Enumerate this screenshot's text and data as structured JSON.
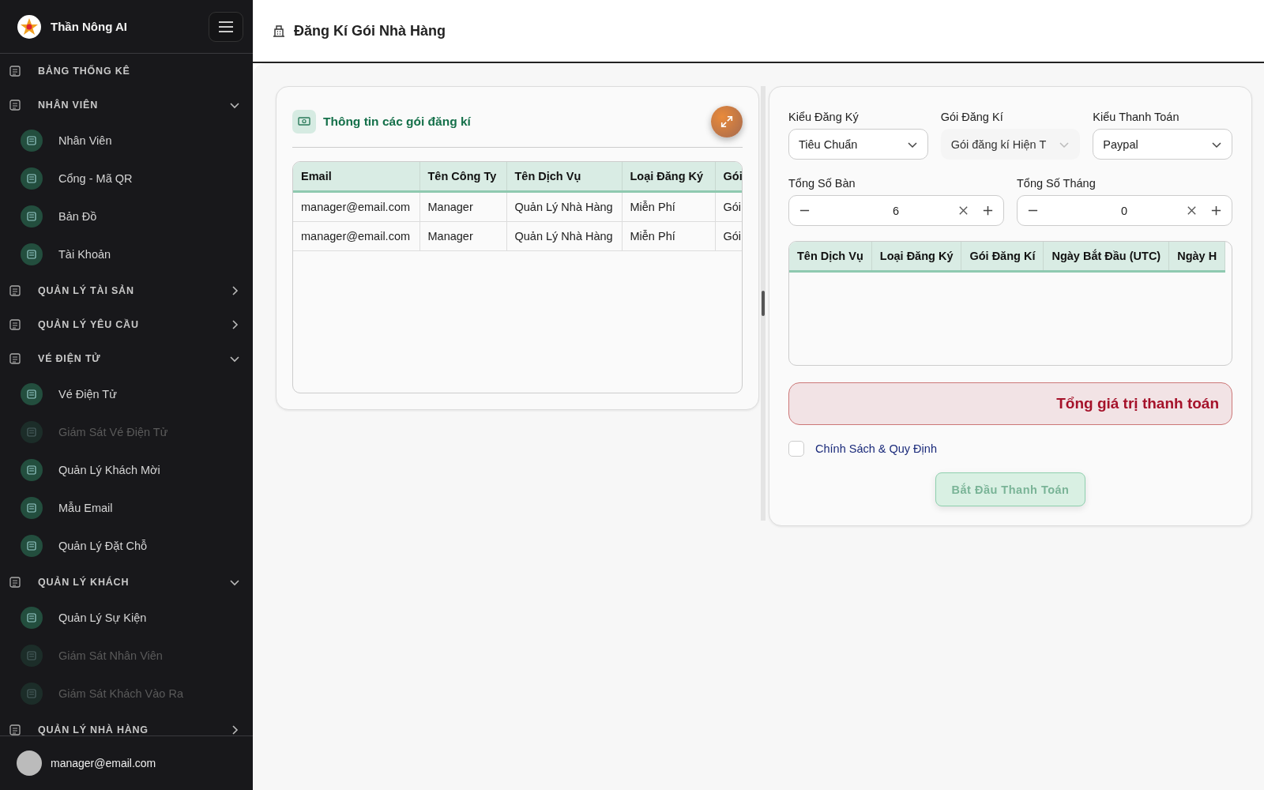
{
  "sidebar": {
    "brand": "Thần Nông AI",
    "items": [
      {
        "kind": "section",
        "label": "BẢNG THỐNG KÊ"
      },
      {
        "kind": "section",
        "label": "NHÂN VIÊN",
        "expanded": true,
        "children": [
          {
            "label": "Nhân Viên",
            "disabled": false
          },
          {
            "label": "Cổng - Mã QR",
            "disabled": false
          },
          {
            "label": "Bản Đồ",
            "disabled": false
          },
          {
            "label": "Tài Khoản",
            "disabled": false
          }
        ]
      },
      {
        "kind": "section",
        "label": "QUẢN LÝ TÀI SẢN",
        "expanded": false
      },
      {
        "kind": "section",
        "label": "QUẢN LÝ YÊU CẦU",
        "expanded": false
      },
      {
        "kind": "section",
        "label": "VÉ ĐIỆN TỬ",
        "expanded": true,
        "children": [
          {
            "label": "Vé Điện Tử",
            "disabled": false
          },
          {
            "label": "Giám Sát Vé Điện Tử",
            "disabled": true
          },
          {
            "label": "Quản Lý Khách Mời",
            "disabled": false
          },
          {
            "label": "Mẫu Email",
            "disabled": false
          },
          {
            "label": "Quản Lý Đặt Chỗ",
            "disabled": false
          }
        ]
      },
      {
        "kind": "section",
        "label": "QUẢN LÝ KHÁCH",
        "expanded": true,
        "children": [
          {
            "label": "Quản Lý Sự Kiện",
            "disabled": false
          },
          {
            "label": "Giám Sát Nhân Viên",
            "disabled": true
          },
          {
            "label": "Giám Sát Khách Vào Ra",
            "disabled": true
          }
        ]
      },
      {
        "kind": "section",
        "label": "QUẢN LÝ NHÀ HÀNG",
        "expanded": false
      }
    ],
    "user": "manager@email.com"
  },
  "page_title": "Đăng Kí Gói Nhà Hàng",
  "packages_panel": {
    "title": "Thông tin các gói đăng kí",
    "table": {
      "columns": [
        "Email",
        "Tên Công Ty",
        "Tên Dịch Vụ",
        "Loại Đăng Ký",
        "Gói"
      ],
      "rows": [
        [
          "manager@email.com",
          "Manager",
          "Quản Lý Nhà Hàng",
          "Miễn Phí",
          "Gói"
        ],
        [
          "manager@email.com",
          "Manager",
          "Quản Lý Nhà Hàng",
          "Miễn Phí",
          "Gói"
        ]
      ]
    }
  },
  "form": {
    "selects": [
      {
        "label": "Kiểu Đăng Ký",
        "value": "Tiêu Chuẩn",
        "disabled": false
      },
      {
        "label": "Gói Đăng Kí",
        "value": "Gói đăng kí Hiện T",
        "disabled": true
      },
      {
        "label": "Kiểu Thanh Toán",
        "value": "Paypal",
        "disabled": false
      }
    ],
    "steppers": [
      {
        "label": "Tổng Số Bàn",
        "value": "6"
      },
      {
        "label": "Tổng Số Tháng",
        "value": "0"
      }
    ],
    "table": {
      "columns": [
        "Tên Dịch Vụ",
        "Loại Đăng Ký",
        "Gói Đăng Kí",
        "Ngày Bắt Đầu (UTC)",
        "Ngày H"
      ]
    },
    "total": "Tổng giá trị thanh toán",
    "policy": {
      "label": "Chính Sách & Quy Định",
      "checked": false
    },
    "submit": {
      "label": "Bắt Đầu Thanh Toán",
      "disabled": true
    }
  }
}
